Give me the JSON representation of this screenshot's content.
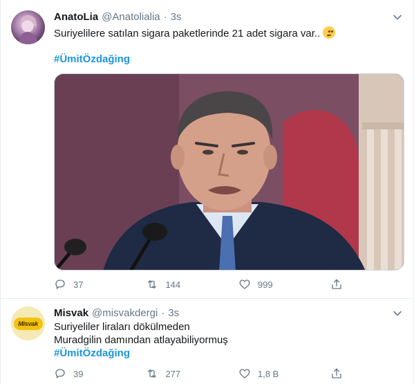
{
  "tweets": [
    {
      "name": "AnatoLia",
      "handle": "@Anatolialia",
      "dot": "·",
      "time": "3s",
      "text": "Suriyelilere satılan sigara paketlerinde 21 adet sigara var..",
      "hashtag": "#ÜmitÖzdağing",
      "avatar_icon": "avatar-icon",
      "media": "photo-man-speaking-at-microphones",
      "replies": "37",
      "retweets": "144",
      "likes": "999"
    },
    {
      "name": "Misvak",
      "handle": "@misvakdergi",
      "dot": "·",
      "time": "3s",
      "avatar_logo": "Misvak",
      "text_line1": "Suriyeliler liraları dökülmeden",
      "text_line2": "Muradgilin damından  atlayabiliyormuş",
      "hashtag": "#ÜmitÖzdağing",
      "replies": "39",
      "retweets": "277",
      "likes": "1,8 B"
    }
  ],
  "colors": {
    "link": "#1b95e0",
    "secondary_text": "#657786",
    "border": "#e6ecf0"
  }
}
